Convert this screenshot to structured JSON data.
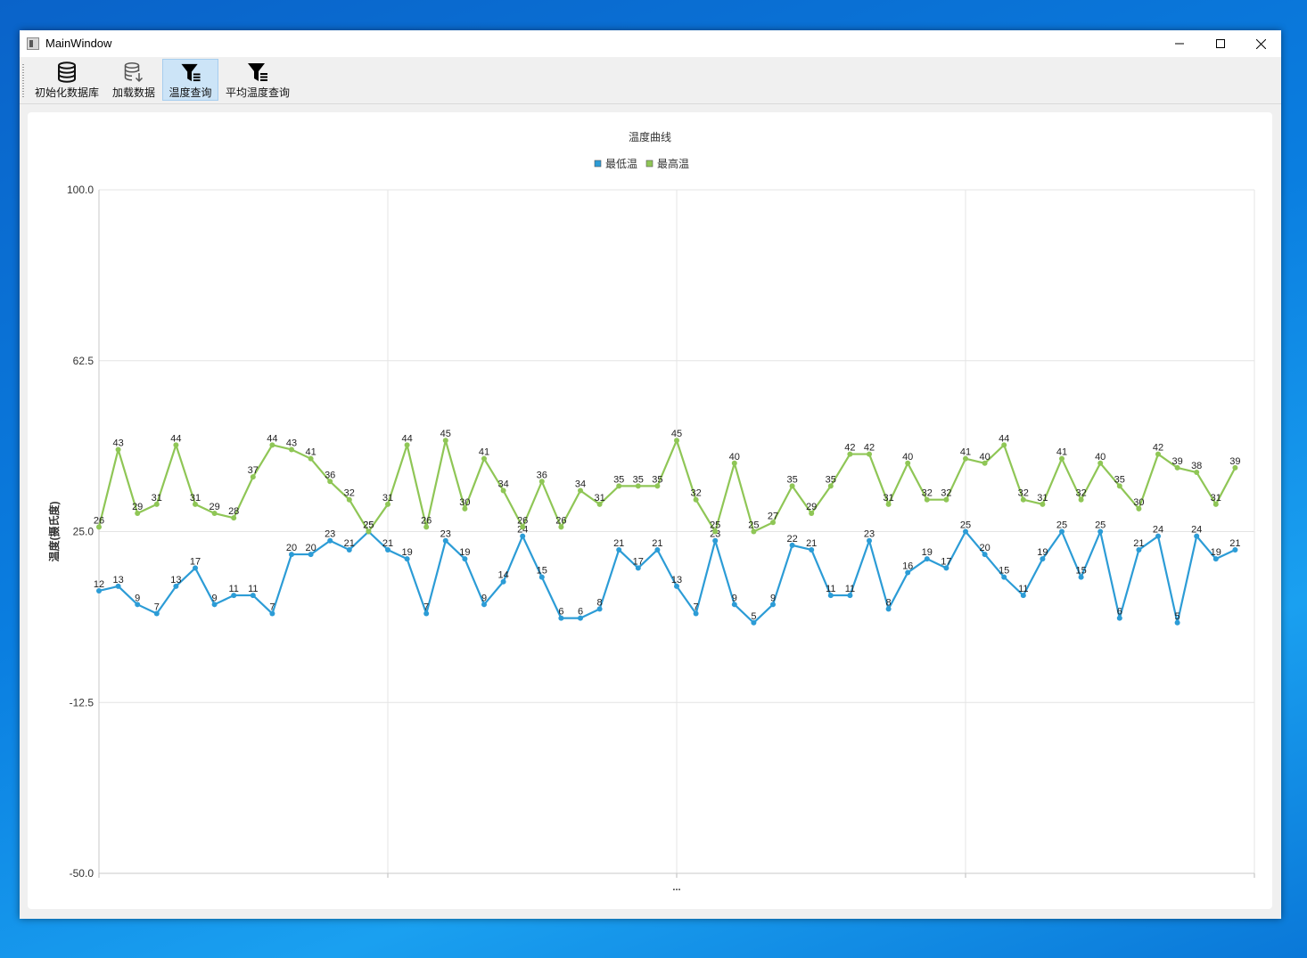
{
  "window": {
    "title": "MainWindow"
  },
  "toolbar": {
    "items": [
      {
        "label": "初始化数据库",
        "icon": "database-icon"
      },
      {
        "label": "加载数据",
        "icon": "database-download-icon"
      },
      {
        "label": "温度查询",
        "icon": "filter-icon"
      },
      {
        "label": "平均温度查询",
        "icon": "filter-list-icon"
      }
    ],
    "active_index": 2
  },
  "colors": {
    "low": "#2c9cd6",
    "high": "#8fc656",
    "grid": "#e4e4e4",
    "selected": "#cce4f7"
  },
  "chart_data": {
    "type": "line",
    "title": "温度曲线",
    "ylabel": "温度(摄氏度)",
    "xlabel": "...",
    "ylim": [
      -50,
      100
    ],
    "yticks": [
      "100.0",
      "62.5",
      "25.0",
      "-12.5",
      "-50.0"
    ],
    "legend_position": "top-center",
    "grid": true,
    "series": [
      {
        "name": "最低温",
        "color": "#2c9cd6",
        "values": [
          12,
          13,
          9,
          7,
          13,
          17,
          9,
          11,
          11,
          7,
          20,
          20,
          23,
          21,
          25,
          21,
          19,
          7,
          23,
          19,
          9,
          14,
          24,
          15,
          6,
          6,
          8,
          21,
          17,
          21,
          13,
          7,
          23,
          9,
          5,
          9,
          22,
          21,
          11,
          11,
          23,
          8,
          16,
          19,
          17,
          25,
          20,
          15,
          11,
          19,
          25,
          15,
          25,
          6,
          21,
          24,
          5,
          24,
          19,
          21
        ]
      },
      {
        "name": "最高温",
        "color": "#8fc656",
        "values": [
          26,
          43,
          29,
          31,
          44,
          31,
          29,
          28,
          37,
          44,
          43,
          41,
          36,
          32,
          25,
          31,
          44,
          26,
          45,
          30,
          41,
          34,
          26,
          36,
          26,
          34,
          31,
          35,
          35,
          35,
          45,
          32,
          25,
          40,
          25,
          27,
          35,
          29,
          35,
          42,
          42,
          31,
          40,
          32,
          32,
          41,
          40,
          44,
          32,
          31,
          41,
          32,
          40,
          35,
          30,
          42,
          39,
          38,
          31,
          39
        ]
      }
    ]
  }
}
